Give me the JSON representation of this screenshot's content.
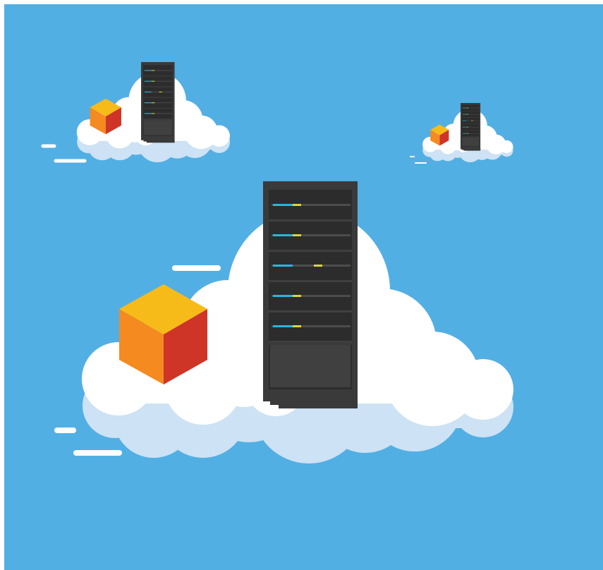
{
  "colors": {
    "sky": "#52afe4",
    "frame": "#ffffff",
    "cloud": "#ffffff",
    "cloud_shadow": "#cde2f4",
    "server_frame": "#3a3a3a",
    "server_panel": "#2c2c2c",
    "server_divider": "#3f3f3f",
    "led_blue": "#27b6e0",
    "led_yellow": "#d8d73c",
    "led_track": "#4c4c4c",
    "cube_top": "#f7bb19",
    "cube_left": "#f48a20",
    "cube_right": "#cf3527",
    "speed_line": "#ffffff"
  },
  "scene": {
    "clouds": [
      {
        "name": "large-cloud",
        "server_bays": 5
      },
      {
        "name": "small-cloud-left",
        "server_bays": 5
      },
      {
        "name": "small-cloud-right",
        "server_bays": 5
      }
    ],
    "icons": [
      "server-rack-icon",
      "cube-icon",
      "cloud-icon"
    ]
  }
}
